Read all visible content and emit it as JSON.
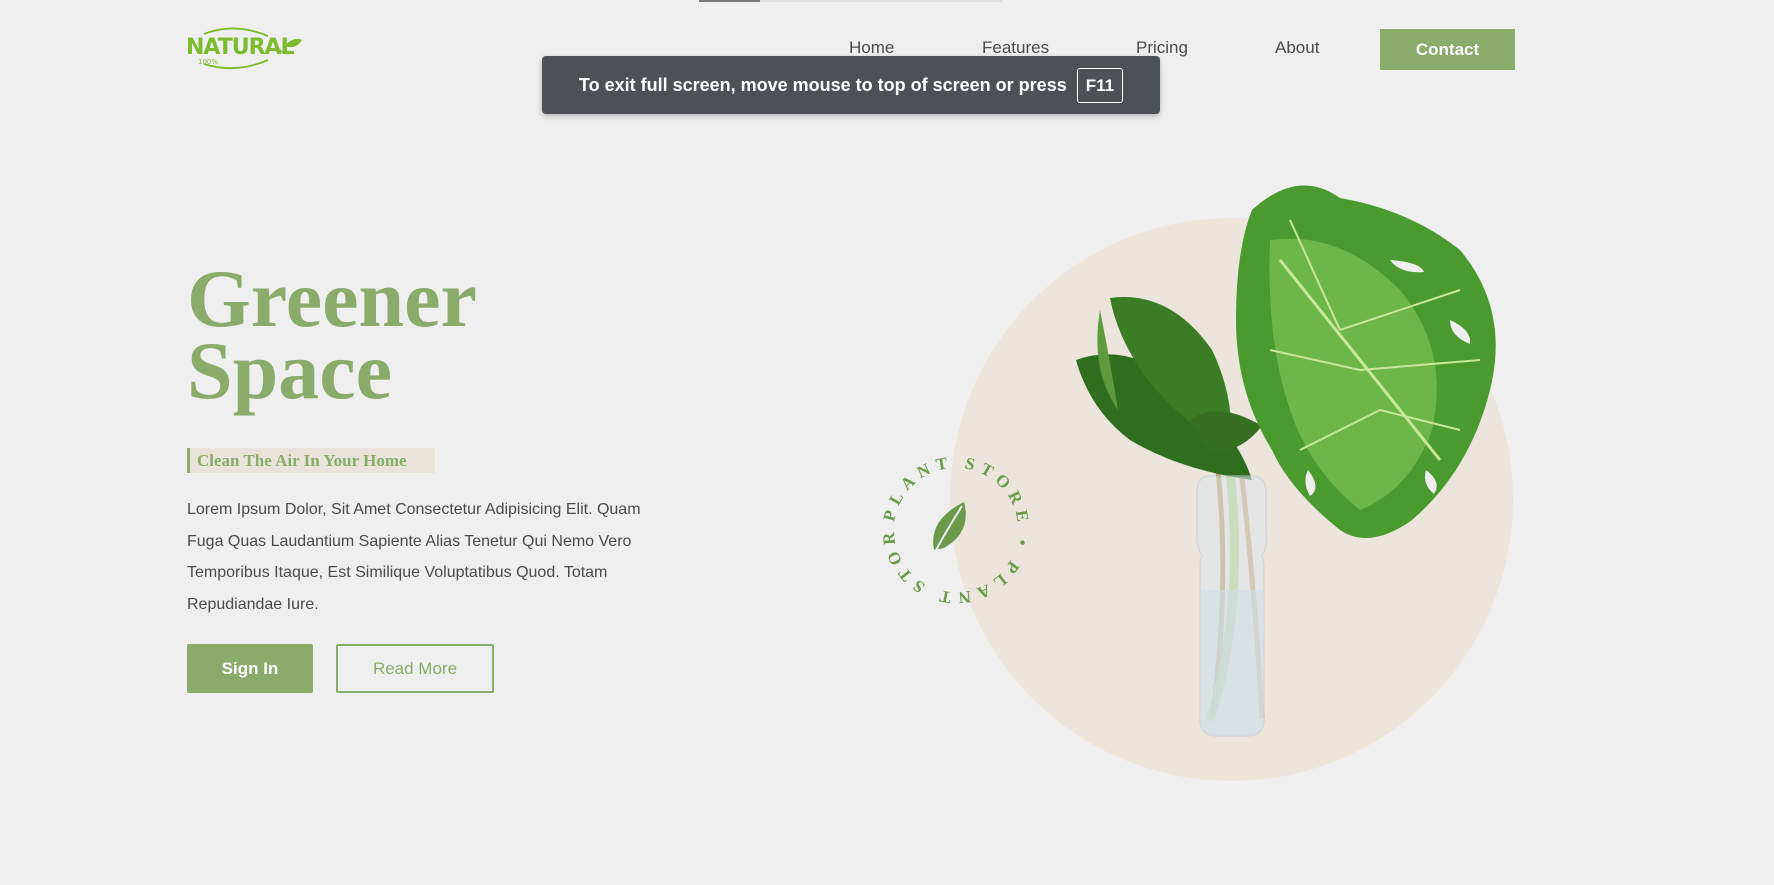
{
  "header": {
    "logo_text": "NATURAL",
    "logo_sub": "100%",
    "nav": [
      "Home",
      "Features",
      "Pricing",
      "About"
    ],
    "contact_label": "Contact"
  },
  "toast": {
    "message": "To exit full screen, move mouse to top of screen or press",
    "key": "F11"
  },
  "hero": {
    "title_line1": "Greener",
    "title_line2": "Space",
    "tagline": "Clean The Air In Your Home",
    "description": "Lorem Ipsum Dolor, Sit Amet Consectetur Adipisicing Elit. Quam Fuga Quas Laudantium Sapiente Alias Tenetur Qui Nemo Vero Temporibus Itaque, Est Similique Voluptatibus Quod. Totam Repudiandae Iure.",
    "signin_label": "Sign In",
    "readmore_label": "Read More"
  },
  "badge": {
    "text": "PLANT STORE • PLANT STORE •"
  },
  "colors": {
    "accent": "#8aab6a",
    "circle": "#ebe5dc",
    "background": "#efefef",
    "logo_green": "#7dbb2e",
    "toast_bg": "#4d5054"
  },
  "icons": [
    "leaf-icon",
    "plant-image"
  ]
}
